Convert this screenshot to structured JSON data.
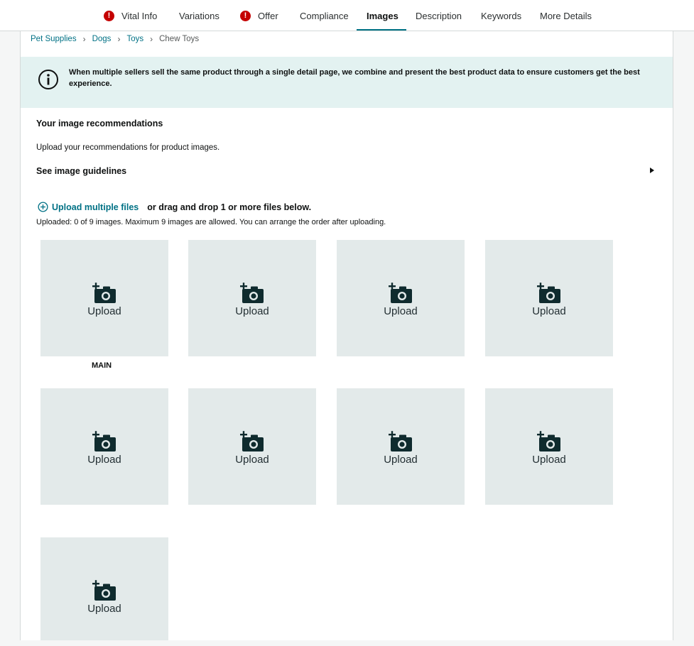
{
  "tabs": [
    {
      "label": "Vital Info",
      "error": true,
      "active": false
    },
    {
      "label": "Variations",
      "error": false,
      "active": false
    },
    {
      "label": "Offer",
      "error": true,
      "active": false
    },
    {
      "label": "Compliance",
      "error": false,
      "active": false
    },
    {
      "label": "Images",
      "error": false,
      "active": true
    },
    {
      "label": "Description",
      "error": false,
      "active": false
    },
    {
      "label": "Keywords",
      "error": false,
      "active": false
    },
    {
      "label": "More Details",
      "error": false,
      "active": false
    }
  ],
  "error_glyph": "!",
  "breadcrumb": [
    "Pet Supplies",
    "Dogs",
    "Toys",
    "Chew Toys"
  ],
  "breadcrumb_sep": "›",
  "info_banner": {
    "text": "When multiple sellers sell the same product through a single detail page, we combine and present the best product data to ensure customers get the best experience."
  },
  "images_section": {
    "title": "Your image recommendations",
    "subtitle": "Upload your recommendations for product images.",
    "guidelines_label": "See image guidelines",
    "upload_multiple_label": "Upload multiple files",
    "drag_drop_text": "or drag and drop 1 or more files below.",
    "status_text": "Uploaded: 0 of 9 images. Maximum 9 images are allowed. You can arrange the order after uploading.",
    "main_label": "MAIN",
    "tiles": [
      {
        "label": "Upload"
      },
      {
        "label": "Upload"
      },
      {
        "label": "Upload"
      },
      {
        "label": "Upload"
      },
      {
        "label": "Upload"
      },
      {
        "label": "Upload"
      },
      {
        "label": "Upload"
      },
      {
        "label": "Upload"
      },
      {
        "label": "Upload"
      }
    ]
  },
  "colors": {
    "accent_teal": "#007185",
    "error_red": "#c40000",
    "banner_bg": "#e3f2f1",
    "tile_bg": "#e3eaea",
    "icon_dark": "#0f2b2e"
  }
}
